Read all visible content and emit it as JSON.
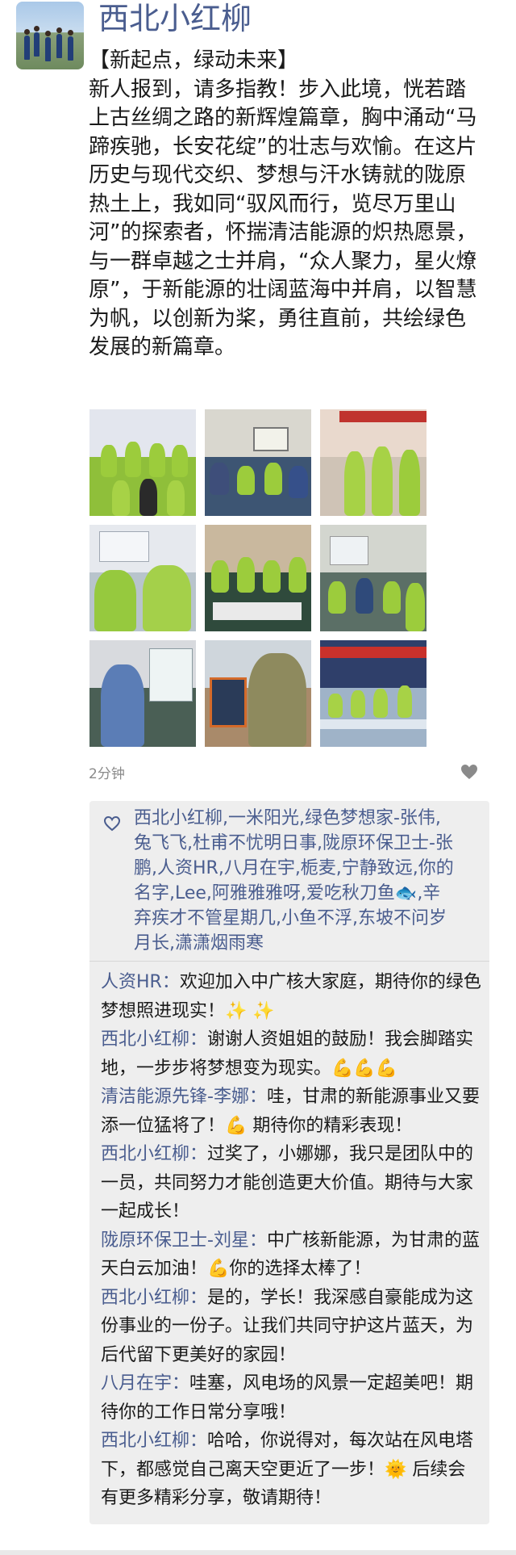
{
  "post": {
    "author": "西北小红柳",
    "title_line": "【新起点，绿动未来】",
    "body": "新人报到，请多指教！步入此境，恍若踏上古丝绸之路的新辉煌篇章，胸中涌动“马蹄疾驰，长安花绽”的壮志与欢愉。在这片历史与现代交织、梦想与汗水铸就的陇原热土上，我如同“驭风而行，览尽万里山河”的探索者，怀揣清洁能源的炽热愿景，与一群卓越之士并肩，“众人聚力，星火燎原”，于新能源的壮阔蓝海中并肩，以智慧为帆，以创新为桨，勇往直前，共绘绿色发展的新篇章。",
    "time": "2分钟",
    "photo_count": 9
  },
  "likes": {
    "icon": "heart-outline-icon",
    "names": "西北小红柳,一米阳光,绿色梦想家-张伟,兔飞飞,杜甫不忧明日事,陇原环保卫士-张鹏,人资HR,八月在宇,栀麦,宁静致远,你的名字,Lee,阿雅雅雅呀,爱吃秋刀鱼🐟,辛弃疾才不管星期几,小鱼不浮,东坡不问岁月长,潇潇烟雨寒"
  },
  "comments": [
    {
      "name": "人资HR",
      "sep": "：",
      "text": "欢迎加入中广核大家庭，期待你的绿色梦想照进现实！✨ ✨"
    },
    {
      "name": "西北小红柳",
      "sep": "：",
      "text": "谢谢人资姐姐的鼓励！我会脚踏实地，一步步将梦想变为现实。💪💪💪"
    },
    {
      "name": "清洁能源先锋-李娜",
      "sep": "：",
      "text": "哇，甘肃的新能源事业又要添一位猛将了！💪 期待你的精彩表现！"
    },
    {
      "name": "西北小红柳",
      "sep": "：",
      "text": "过奖了，小娜娜，我只是团队中的一员，共同努力才能创造更大价值。期待与大家一起成长！"
    },
    {
      "name": "陇原环保卫士-刘星",
      "sep": "：",
      "text": "中广核新能源，为甘肃的蓝天白云加油！💪你的选择太棒了！"
    },
    {
      "name": "西北小红柳",
      "sep": "：",
      "text": "是的，学长！我深感自豪能成为这份事业的一份子。让我们共同守护这片蓝天，为后代留下更美好的家园！"
    },
    {
      "name": "八月在宇",
      "sep": "：",
      "text": "哇塞，风电场的风景一定超美吧！期待你的工作日常分享哦！"
    },
    {
      "name": "西北小红柳",
      "sep": "：",
      "text": "哈哈，你说得对，每次站在风电塔下，都感觉自己离天空更近了一步！🌞 后续会有更多精彩分享，敬请期待！"
    }
  ],
  "colors": {
    "name_blue": "#4a5d8f",
    "panel_bg": "#eeeeee",
    "time_gray": "#8a8a8a"
  }
}
